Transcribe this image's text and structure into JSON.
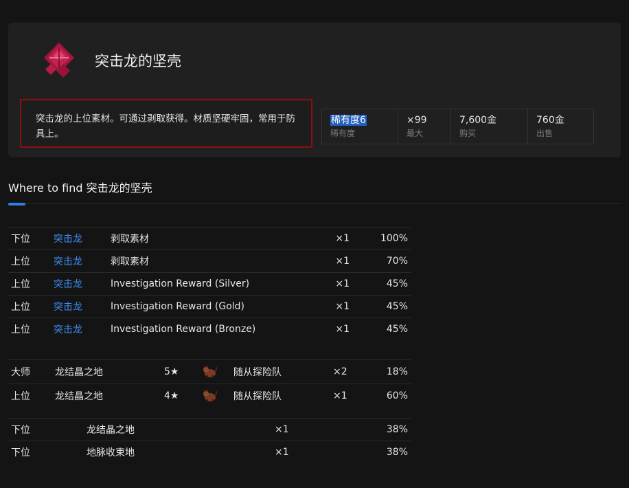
{
  "item": {
    "title": "突击龙的坚壳",
    "icon": "crimson-diamond-shell-icon",
    "description": "突击龙的上位素材。可通过剥取获得。材质坚硬牢固，常用于防具上。",
    "accent_color": "#c2224d"
  },
  "stats": [
    {
      "value": "稀有度6",
      "label": "稀有度"
    },
    {
      "value": "×99",
      "label": "最大"
    },
    {
      "value": "7,600金",
      "label": "购买"
    },
    {
      "value": "760金",
      "label": "出售"
    }
  ],
  "section": {
    "title": "Where to find 突击龙的坚壳"
  },
  "monster_drops": [
    {
      "rank": "下位",
      "monster": "突击龙",
      "method": "剥取素材",
      "qty": "×1",
      "chance": "100%"
    },
    {
      "rank": "上位",
      "monster": "突击龙",
      "method": "剥取素材",
      "qty": "×1",
      "chance": "70%"
    },
    {
      "rank": "上位",
      "monster": "突击龙",
      "method": "Investigation Reward (Silver)",
      "qty": "×1",
      "chance": "45%"
    },
    {
      "rank": "上位",
      "monster": "突击龙",
      "method": "Investigation Reward (Gold)",
      "qty": "×1",
      "chance": "45%"
    },
    {
      "rank": "上位",
      "monster": "突击龙",
      "method": "Investigation Reward (Bronze)",
      "qty": "×1",
      "chance": "45%"
    }
  ],
  "expeditions": [
    {
      "rank": "大师",
      "area": "龙结晶之地",
      "stars": "5★",
      "icon": "palico-icon",
      "source": "随从探险队",
      "qty": "×2",
      "chance": "18%"
    },
    {
      "rank": "上位",
      "area": "龙结晶之地",
      "stars": "4★",
      "icon": "palico-icon",
      "source": "随从探险队",
      "qty": "×1",
      "chance": "60%"
    }
  ],
  "gathering": [
    {
      "rank": "下位",
      "area": "龙结晶之地",
      "qty": "×1",
      "chance": "38%"
    },
    {
      "rank": "下位",
      "area": "地脉收束地",
      "qty": "×1",
      "chance": "38%"
    }
  ]
}
